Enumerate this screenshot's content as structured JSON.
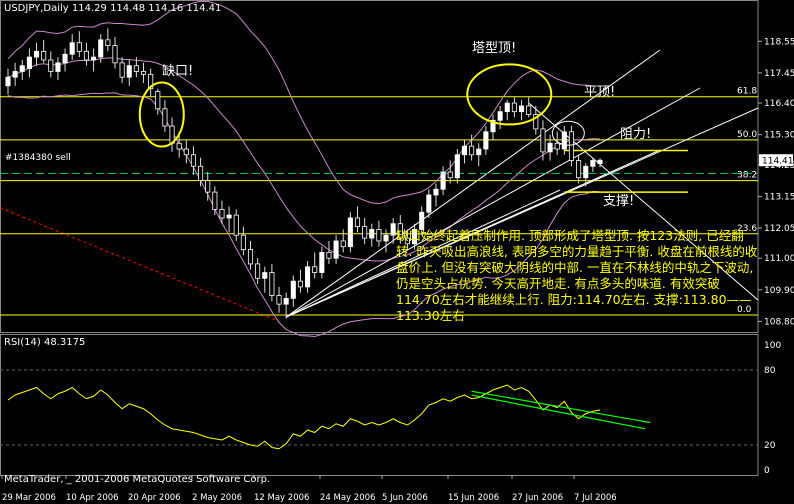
{
  "header": {
    "main_title": "USDJPY,Daily  114.29 114.48 114.16 114.41",
    "rsi_title": "RSI(14) 48.3175",
    "copyright": "MetaTrader, _ 2001-2006 MetaQuotes Software Corp."
  },
  "annotations": {
    "gap": "缺口!",
    "tower_top": "塔型顶!",
    "flat_top": "平顶!",
    "resistance": "阻力!",
    "support": "支撑!",
    "order": "#1384380 sell",
    "comment": "缺口始终起着压制作用. 顶部形成了塔型顶. 按123法则, 已经翻转. 昨天吸出高浪线, 表明多空的力量趋于平衡. 收盘在前根线的收盘价上. 但没有突破大阴线的中部. 一直在不林线的中轨之下波动, 仍是空头占优势. 今天高开地走. 有点多头的味道. 有效突破114.70左右才能继续上行. 阻力:114.70左右. 支撑:113.80——113.30左右"
  },
  "fib_levels": [
    {
      "label": "61.8",
      "price": 116.62
    },
    {
      "label": "50.0",
      "price": 115.12
    },
    {
      "label": "38.2",
      "price": 113.7
    },
    {
      "label": "23.6",
      "price": 111.85
    },
    {
      "label": "0.0",
      "price": 109.02
    }
  ],
  "colors": {
    "background": "#000000",
    "bull_candle": "#ffffff",
    "bear_candle": "#000000",
    "bollinger": "#cc88cc",
    "fib": "#ffff00",
    "trend": "#ffffff",
    "rsi": "#ffff00",
    "rsi_channel": "#00ff00",
    "dashed_red": "#ff0000",
    "order_line": "#00cc66",
    "annotation_circle": "#ffff00"
  },
  "chart_data": [
    {
      "type": "candlestick",
      "title": "USDJPY,Daily",
      "ohlc_last": {
        "open": 114.29,
        "high": 114.48,
        "low": 114.16,
        "close": 114.41
      },
      "current_price": "114.41",
      "ylim": [
        108.5,
        119.5
      ],
      "y_ticks": [
        "118.55",
        "117.45",
        "116.40",
        "115.30",
        "114.25",
        "113.15",
        "112.05",
        "111.00",
        "109.90",
        "108.80"
      ],
      "x_ticks": [
        "29 Mar 2006",
        "10 Apr 2006",
        "20 Apr 2006",
        "2 May 2006",
        "12 May 2006",
        "24 May 2006",
        "5 Jun 2006",
        "15 Jun 2006",
        "27 Jun 2006",
        "7 Jul 2006"
      ],
      "bars": [
        [
          117.0,
          117.6,
          116.7,
          117.3
        ],
        [
          117.3,
          117.8,
          117.0,
          117.5
        ],
        [
          117.5,
          117.9,
          117.2,
          117.7
        ],
        [
          117.6,
          118.3,
          117.3,
          118.0
        ],
        [
          118.0,
          118.5,
          117.7,
          118.2
        ],
        [
          118.2,
          118.6,
          117.8,
          117.9
        ],
        [
          117.9,
          118.2,
          117.3,
          117.5
        ],
        [
          117.5,
          118.0,
          117.2,
          117.8
        ],
        [
          117.8,
          118.3,
          117.5,
          118.1
        ],
        [
          118.1,
          118.8,
          117.9,
          118.5
        ],
        [
          118.5,
          118.9,
          118.0,
          118.2
        ],
        [
          118.2,
          118.5,
          117.7,
          117.9
        ],
        [
          117.9,
          118.3,
          117.5,
          118.0
        ],
        [
          118.0,
          118.8,
          117.8,
          118.6
        ],
        [
          118.6,
          119.0,
          118.2,
          118.4
        ],
        [
          118.4,
          118.7,
          117.6,
          117.8
        ],
        [
          117.8,
          118.0,
          117.1,
          117.3
        ],
        [
          117.3,
          117.9,
          117.0,
          117.7
        ],
        [
          117.7,
          118.0,
          117.3,
          117.5
        ],
        [
          117.5,
          117.8,
          117.1,
          117.4
        ],
        [
          117.4,
          117.6,
          116.6,
          116.9
        ],
        [
          116.8,
          116.9,
          116.0,
          116.2
        ],
        [
          116.2,
          116.5,
          115.4,
          115.6
        ],
        [
          115.6,
          115.9,
          114.7,
          115.0
        ],
        [
          115.0,
          115.4,
          114.5,
          114.8
        ],
        [
          114.8,
          115.1,
          114.3,
          114.6
        ],
        [
          114.6,
          114.9,
          113.9,
          114.2
        ],
        [
          114.2,
          114.5,
          113.5,
          113.7
        ],
        [
          113.7,
          114.0,
          113.0,
          113.3
        ],
        [
          113.3,
          113.5,
          112.5,
          112.7
        ],
        [
          112.7,
          113.0,
          112.2,
          112.4
        ],
        [
          112.4,
          112.8,
          111.9,
          112.5
        ],
        [
          112.5,
          112.7,
          111.6,
          111.8
        ],
        [
          111.8,
          112.1,
          111.1,
          111.3
        ],
        [
          111.3,
          111.6,
          110.6,
          110.8
        ],
        [
          110.8,
          111.0,
          110.1,
          110.3
        ],
        [
          110.3,
          110.7,
          109.8,
          110.5
        ],
        [
          110.5,
          110.8,
          109.5,
          109.7
        ],
        [
          109.7,
          110.0,
          109.1,
          109.4
        ],
        [
          109.4,
          109.8,
          108.9,
          109.6
        ],
        [
          109.6,
          110.4,
          109.3,
          110.2
        ],
        [
          110.2,
          110.6,
          109.8,
          110.0
        ],
        [
          110.0,
          110.9,
          109.8,
          110.7
        ],
        [
          110.7,
          111.2,
          110.3,
          110.5
        ],
        [
          110.5,
          111.4,
          110.3,
          111.2
        ],
        [
          111.2,
          111.6,
          110.8,
          111.0
        ],
        [
          111.0,
          111.8,
          110.8,
          111.6
        ],
        [
          111.6,
          112.0,
          111.2,
          111.4
        ],
        [
          111.4,
          112.6,
          111.2,
          112.4
        ],
        [
          112.4,
          112.8,
          111.9,
          112.1
        ],
        [
          112.1,
          112.4,
          111.5,
          111.7
        ],
        [
          111.7,
          112.2,
          111.4,
          112.0
        ],
        [
          112.0,
          112.3,
          111.4,
          111.6
        ],
        [
          111.6,
          112.0,
          111.2,
          111.8
        ],
        [
          111.8,
          112.4,
          111.5,
          112.2
        ],
        [
          112.2,
          112.5,
          111.5,
          111.7
        ],
        [
          111.7,
          112.0,
          111.3,
          111.5
        ],
        [
          111.5,
          112.2,
          111.3,
          112.0
        ],
        [
          112.0,
          112.8,
          111.8,
          112.6
        ],
        [
          112.6,
          113.4,
          112.4,
          113.2
        ],
        [
          113.2,
          113.6,
          112.8,
          113.4
        ],
        [
          113.4,
          114.2,
          113.2,
          114.0
        ],
        [
          114.0,
          114.4,
          113.6,
          113.8
        ],
        [
          113.8,
          114.8,
          113.6,
          114.6
        ],
        [
          114.6,
          115.1,
          114.3,
          114.9
        ],
        [
          114.9,
          115.3,
          114.4,
          114.6
        ],
        [
          114.6,
          115.0,
          114.2,
          114.8
        ],
        [
          114.8,
          115.6,
          114.6,
          115.4
        ],
        [
          115.4,
          116.0,
          115.1,
          115.8
        ],
        [
          115.8,
          116.3,
          115.5,
          116.1
        ],
        [
          116.1,
          116.5,
          115.8,
          116.4
        ],
        [
          116.4,
          116.6,
          115.9,
          116.1
        ],
        [
          116.1,
          116.5,
          115.8,
          116.3
        ],
        [
          116.3,
          116.6,
          115.9,
          116.0
        ],
        [
          116.0,
          116.3,
          115.3,
          115.5
        ],
        [
          115.5,
          115.8,
          114.4,
          114.7
        ],
        [
          114.7,
          115.3,
          114.4,
          115.0
        ],
        [
          115.0,
          115.4,
          114.6,
          114.8
        ],
        [
          114.8,
          115.6,
          114.6,
          115.4
        ],
        [
          115.4,
          115.6,
          114.2,
          114.4
        ],
        [
          114.4,
          114.6,
          113.6,
          113.8
        ],
        [
          113.8,
          114.3,
          113.5,
          114.2
        ],
        [
          114.2,
          114.5,
          114.0,
          114.4
        ],
        [
          114.29,
          114.48,
          114.16,
          114.41
        ]
      ],
      "indicators": [
        "Bollinger Bands",
        "Fibonacci retracement",
        "Gann fan"
      ]
    },
    {
      "type": "line",
      "title": "RSI(14) 48.3175",
      "ylim": [
        0,
        100
      ],
      "y_ticks": [
        "100",
        "80",
        "20",
        "0"
      ],
      "values": [
        56,
        60,
        62,
        64,
        66,
        61,
        57,
        61,
        63,
        66,
        61,
        57,
        59,
        64,
        60,
        54,
        49,
        53,
        51,
        49,
        45,
        40,
        36,
        33,
        32,
        31,
        30,
        28,
        26,
        25,
        24,
        27,
        24,
        22,
        20,
        19,
        23,
        18,
        17,
        21,
        29,
        27,
        32,
        30,
        35,
        33,
        37,
        35,
        41,
        39,
        36,
        38,
        36,
        38,
        41,
        38,
        36,
        40,
        45,
        52,
        54,
        57,
        55,
        58,
        60,
        57,
        58,
        61,
        64,
        66,
        68,
        64,
        66,
        63,
        56,
        48,
        52,
        50,
        55,
        46,
        41,
        45,
        47,
        48
      ]
    }
  ]
}
